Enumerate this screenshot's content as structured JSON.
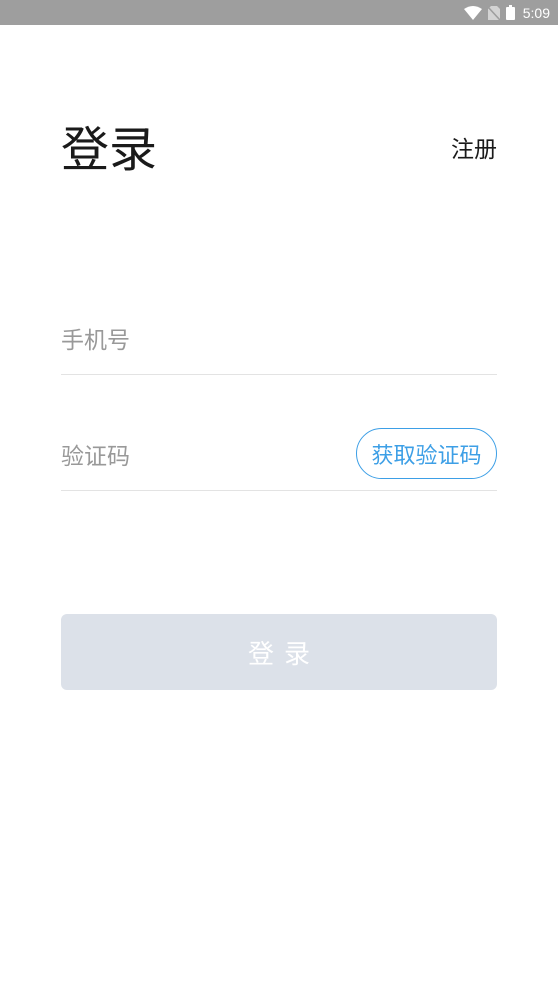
{
  "status_bar": {
    "time": "5:09",
    "icons": [
      "wifi-icon",
      "no-sim-icon",
      "battery-icon"
    ]
  },
  "header": {
    "title": "登录",
    "register_label": "注册"
  },
  "form": {
    "phone_placeholder": "手机号",
    "code_placeholder": "验证码",
    "get_code_label": "获取验证码",
    "login_label": "登录"
  },
  "colors": {
    "status_bar": "#9e9e9e",
    "accent": "#3d9fe6",
    "login_button_disabled": "#dce1e9",
    "divider": "#e3e3e3"
  }
}
